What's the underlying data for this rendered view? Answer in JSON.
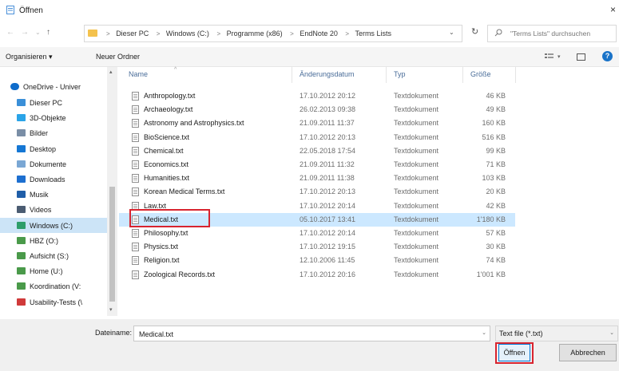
{
  "window": {
    "title": "Öffnen",
    "close_glyph": "×"
  },
  "nav_buttons": {
    "back": "←",
    "forward": "→",
    "dropdown": "⌄",
    "up": "↑"
  },
  "address": {
    "crumbs": [
      "Dieser PC",
      "Windows (C:)",
      "Programme (x86)",
      "EndNote 20",
      "Terms Lists"
    ],
    "separator": ">",
    "dropdown_glyph": "⌄",
    "refresh_glyph": "↻"
  },
  "search": {
    "placeholder": "\"Terms Lists\" durchsuchen",
    "icon": "search-icon"
  },
  "toolbar": {
    "organize": "Organisieren ▾",
    "new_folder": "Neuer Ordner",
    "help": "?"
  },
  "nav_pane": {
    "items": [
      {
        "label": "OneDrive - Univer",
        "icon": "cloud-icon",
        "color": "#0f6ccb"
      },
      {
        "label": "Dieser PC",
        "icon": "computer-icon",
        "color": "#3a8fd8"
      },
      {
        "label": "3D-Objekte",
        "icon": "cube-icon",
        "color": "#2aa4e8"
      },
      {
        "label": "Bilder",
        "icon": "pictures-icon",
        "color": "#7a8ea6"
      },
      {
        "label": "Desktop",
        "icon": "desktop-icon",
        "color": "#1577d4"
      },
      {
        "label": "Dokumente",
        "icon": "documents-icon",
        "color": "#7aa7d4"
      },
      {
        "label": "Downloads",
        "icon": "download-icon",
        "color": "#1d6fd0"
      },
      {
        "label": "Musik",
        "icon": "music-icon",
        "color": "#1f5ea8"
      },
      {
        "label": "Videos",
        "icon": "videos-icon",
        "color": "#4b5c72"
      },
      {
        "label": "Windows (C:)",
        "icon": "drive-icon",
        "color": "#2f9e6a"
      },
      {
        "label": "HBZ (O:)",
        "icon": "network-drive-icon",
        "color": "#4a9a4a"
      },
      {
        "label": "Aufsicht (S:)",
        "icon": "network-drive-icon",
        "color": "#4a9a4a"
      },
      {
        "label": "Home (U:)",
        "icon": "network-drive-icon",
        "color": "#4a9a4a"
      },
      {
        "label": "Koordination (V:",
        "icon": "network-drive-icon",
        "color": "#4a9a4a"
      },
      {
        "label": "Usability-Tests (\\",
        "icon": "disconnected-drive-icon",
        "color": "#d03a3a"
      }
    ],
    "selected_index": 9,
    "scroll_up": "▴",
    "scroll_down": "▾"
  },
  "columns": {
    "name": "Name",
    "date": "Änderungsdatum",
    "type": "Typ",
    "size": "Größe",
    "sort_glyph": "^"
  },
  "files": [
    {
      "name": "Anthropology.txt",
      "date": "17.10.2012 20:12",
      "type": "Textdokument",
      "size": "46 KB"
    },
    {
      "name": "Archaeology.txt",
      "date": "26.02.2013 09:38",
      "type": "Textdokument",
      "size": "49 KB"
    },
    {
      "name": "Astronomy and Astrophysics.txt",
      "date": "21.09.2011 11:37",
      "type": "Textdokument",
      "size": "160 KB"
    },
    {
      "name": "BioScience.txt",
      "date": "17.10.2012 20:13",
      "type": "Textdokument",
      "size": "516 KB"
    },
    {
      "name": "Chemical.txt",
      "date": "22.05.2018 17:54",
      "type": "Textdokument",
      "size": "99 KB"
    },
    {
      "name": "Economics.txt",
      "date": "21.09.2011 11:32",
      "type": "Textdokument",
      "size": "71 KB"
    },
    {
      "name": "Humanities.txt",
      "date": "21.09.2011 11:38",
      "type": "Textdokument",
      "size": "103 KB"
    },
    {
      "name": "Korean Medical Terms.txt",
      "date": "17.10.2012 20:13",
      "type": "Textdokument",
      "size": "20 KB"
    },
    {
      "name": "Law.txt",
      "date": "17.10.2012 20:14",
      "type": "Textdokument",
      "size": "42 KB"
    },
    {
      "name": "Medical.txt",
      "date": "05.10.2017 13:41",
      "type": "Textdokument",
      "size": "1'180 KB"
    },
    {
      "name": "Philosophy.txt",
      "date": "17.10.2012 20:14",
      "type": "Textdokument",
      "size": "57 KB"
    },
    {
      "name": "Physics.txt",
      "date": "17.10.2012 19:15",
      "type": "Textdokument",
      "size": "30 KB"
    },
    {
      "name": "Religion.txt",
      "date": "12.10.2006 11:45",
      "type": "Textdokument",
      "size": "74 KB"
    },
    {
      "name": "Zoological Records.txt",
      "date": "17.10.2012 20:16",
      "type": "Textdokument",
      "size": "1'001 KB"
    }
  ],
  "selected_file_index": 9,
  "bottom": {
    "filename_label": "Dateiname:",
    "filename_value": "Medical.txt",
    "filetype_value": "Text file (*.txt)",
    "dropdown_glyph": "⌄",
    "open_label": "Öffnen",
    "cancel_label": "Abbrechen"
  },
  "colors": {
    "selection": "#cce8ff",
    "highlight": "#d8242f",
    "accent": "#0078d7"
  }
}
